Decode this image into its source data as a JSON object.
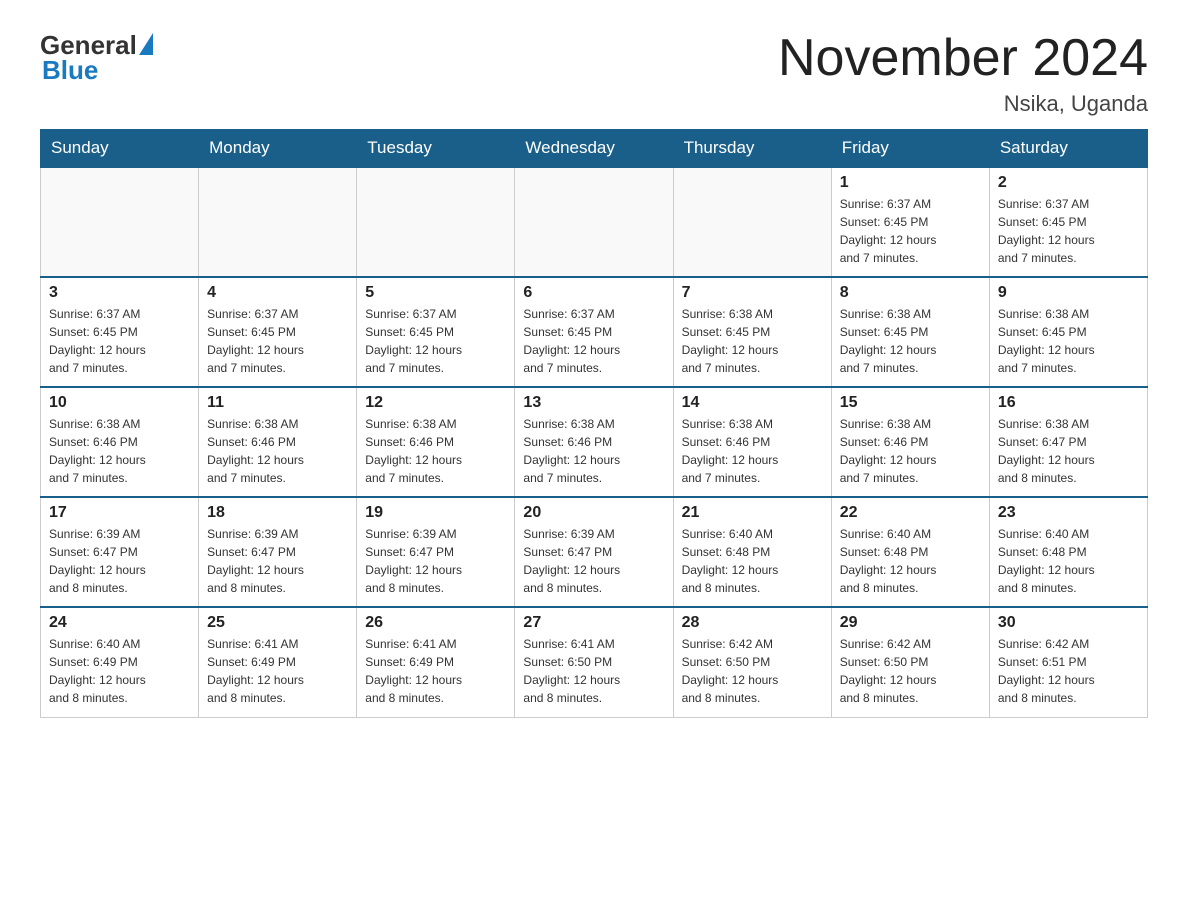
{
  "logo": {
    "general": "General",
    "triangle": "▶",
    "blue": "Blue"
  },
  "title": "November 2024",
  "subtitle": "Nsika, Uganda",
  "days_of_week": [
    "Sunday",
    "Monday",
    "Tuesday",
    "Wednesday",
    "Thursday",
    "Friday",
    "Saturday"
  ],
  "weeks": [
    [
      {
        "day": "",
        "info": ""
      },
      {
        "day": "",
        "info": ""
      },
      {
        "day": "",
        "info": ""
      },
      {
        "day": "",
        "info": ""
      },
      {
        "day": "",
        "info": ""
      },
      {
        "day": "1",
        "info": "Sunrise: 6:37 AM\nSunset: 6:45 PM\nDaylight: 12 hours\nand 7 minutes."
      },
      {
        "day": "2",
        "info": "Sunrise: 6:37 AM\nSunset: 6:45 PM\nDaylight: 12 hours\nand 7 minutes."
      }
    ],
    [
      {
        "day": "3",
        "info": "Sunrise: 6:37 AM\nSunset: 6:45 PM\nDaylight: 12 hours\nand 7 minutes."
      },
      {
        "day": "4",
        "info": "Sunrise: 6:37 AM\nSunset: 6:45 PM\nDaylight: 12 hours\nand 7 minutes."
      },
      {
        "day": "5",
        "info": "Sunrise: 6:37 AM\nSunset: 6:45 PM\nDaylight: 12 hours\nand 7 minutes."
      },
      {
        "day": "6",
        "info": "Sunrise: 6:37 AM\nSunset: 6:45 PM\nDaylight: 12 hours\nand 7 minutes."
      },
      {
        "day": "7",
        "info": "Sunrise: 6:38 AM\nSunset: 6:45 PM\nDaylight: 12 hours\nand 7 minutes."
      },
      {
        "day": "8",
        "info": "Sunrise: 6:38 AM\nSunset: 6:45 PM\nDaylight: 12 hours\nand 7 minutes."
      },
      {
        "day": "9",
        "info": "Sunrise: 6:38 AM\nSunset: 6:45 PM\nDaylight: 12 hours\nand 7 minutes."
      }
    ],
    [
      {
        "day": "10",
        "info": "Sunrise: 6:38 AM\nSunset: 6:46 PM\nDaylight: 12 hours\nand 7 minutes."
      },
      {
        "day": "11",
        "info": "Sunrise: 6:38 AM\nSunset: 6:46 PM\nDaylight: 12 hours\nand 7 minutes."
      },
      {
        "day": "12",
        "info": "Sunrise: 6:38 AM\nSunset: 6:46 PM\nDaylight: 12 hours\nand 7 minutes."
      },
      {
        "day": "13",
        "info": "Sunrise: 6:38 AM\nSunset: 6:46 PM\nDaylight: 12 hours\nand 7 minutes."
      },
      {
        "day": "14",
        "info": "Sunrise: 6:38 AM\nSunset: 6:46 PM\nDaylight: 12 hours\nand 7 minutes."
      },
      {
        "day": "15",
        "info": "Sunrise: 6:38 AM\nSunset: 6:46 PM\nDaylight: 12 hours\nand 7 minutes."
      },
      {
        "day": "16",
        "info": "Sunrise: 6:38 AM\nSunset: 6:47 PM\nDaylight: 12 hours\nand 8 minutes."
      }
    ],
    [
      {
        "day": "17",
        "info": "Sunrise: 6:39 AM\nSunset: 6:47 PM\nDaylight: 12 hours\nand 8 minutes."
      },
      {
        "day": "18",
        "info": "Sunrise: 6:39 AM\nSunset: 6:47 PM\nDaylight: 12 hours\nand 8 minutes."
      },
      {
        "day": "19",
        "info": "Sunrise: 6:39 AM\nSunset: 6:47 PM\nDaylight: 12 hours\nand 8 minutes."
      },
      {
        "day": "20",
        "info": "Sunrise: 6:39 AM\nSunset: 6:47 PM\nDaylight: 12 hours\nand 8 minutes."
      },
      {
        "day": "21",
        "info": "Sunrise: 6:40 AM\nSunset: 6:48 PM\nDaylight: 12 hours\nand 8 minutes."
      },
      {
        "day": "22",
        "info": "Sunrise: 6:40 AM\nSunset: 6:48 PM\nDaylight: 12 hours\nand 8 minutes."
      },
      {
        "day": "23",
        "info": "Sunrise: 6:40 AM\nSunset: 6:48 PM\nDaylight: 12 hours\nand 8 minutes."
      }
    ],
    [
      {
        "day": "24",
        "info": "Sunrise: 6:40 AM\nSunset: 6:49 PM\nDaylight: 12 hours\nand 8 minutes."
      },
      {
        "day": "25",
        "info": "Sunrise: 6:41 AM\nSunset: 6:49 PM\nDaylight: 12 hours\nand 8 minutes."
      },
      {
        "day": "26",
        "info": "Sunrise: 6:41 AM\nSunset: 6:49 PM\nDaylight: 12 hours\nand 8 minutes."
      },
      {
        "day": "27",
        "info": "Sunrise: 6:41 AM\nSunset: 6:50 PM\nDaylight: 12 hours\nand 8 minutes."
      },
      {
        "day": "28",
        "info": "Sunrise: 6:42 AM\nSunset: 6:50 PM\nDaylight: 12 hours\nand 8 minutes."
      },
      {
        "day": "29",
        "info": "Sunrise: 6:42 AM\nSunset: 6:50 PM\nDaylight: 12 hours\nand 8 minutes."
      },
      {
        "day": "30",
        "info": "Sunrise: 6:42 AM\nSunset: 6:51 PM\nDaylight: 12 hours\nand 8 minutes."
      }
    ]
  ]
}
